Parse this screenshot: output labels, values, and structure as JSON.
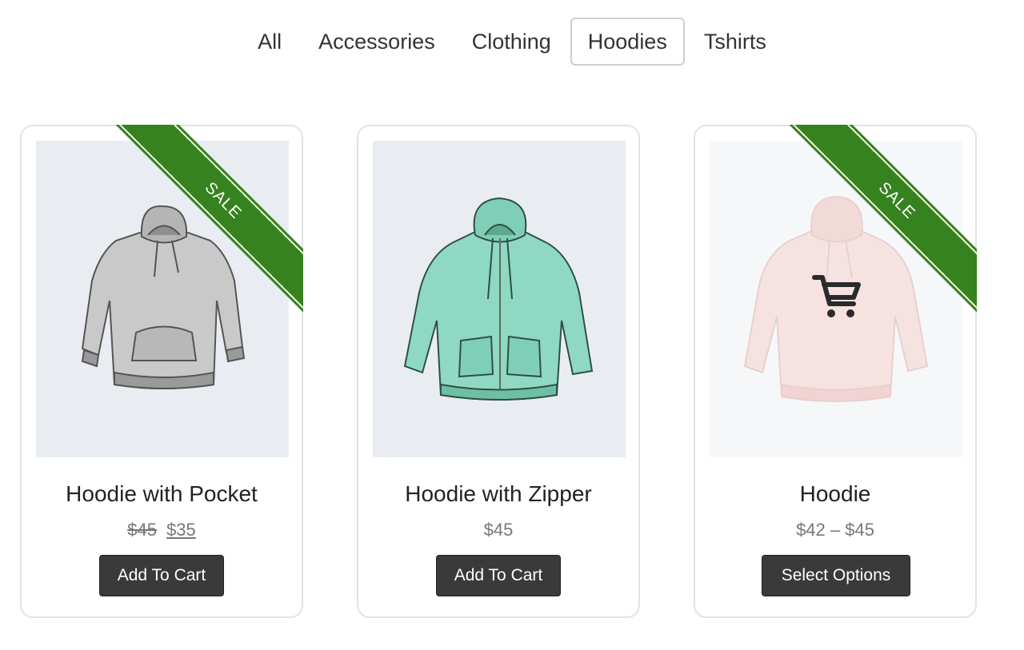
{
  "tabs": [
    {
      "label": "All",
      "active": false
    },
    {
      "label": "Accessories",
      "active": false
    },
    {
      "label": "Clothing",
      "active": false
    },
    {
      "label": "Hoodies",
      "active": true
    },
    {
      "label": "Tshirts",
      "active": false
    }
  ],
  "products": [
    {
      "title": "Hoodie with Pocket",
      "price_old": "$45",
      "price_new": "$35",
      "button": "Add To Cart",
      "badge": "SALE",
      "color": "#c9c9c9",
      "image_icon": "gray-pocket-hoodie"
    },
    {
      "title": "Hoodie with Zipper",
      "price": "$45",
      "button": "Add To Cart",
      "color": "#8fd9c2",
      "image_icon": "teal-zip-hoodie"
    },
    {
      "title": "Hoodie",
      "price": "$42 – $45",
      "button": "Select Options",
      "badge": "SALE",
      "color": "#f4c9c6",
      "image_icon": "pink-hoodie",
      "overlay_icon": "cart-icon"
    }
  ],
  "colors": {
    "sale_ribbon": "#36821f",
    "button_bg": "#3a3a3a",
    "image_bg": "#e9edf2"
  }
}
